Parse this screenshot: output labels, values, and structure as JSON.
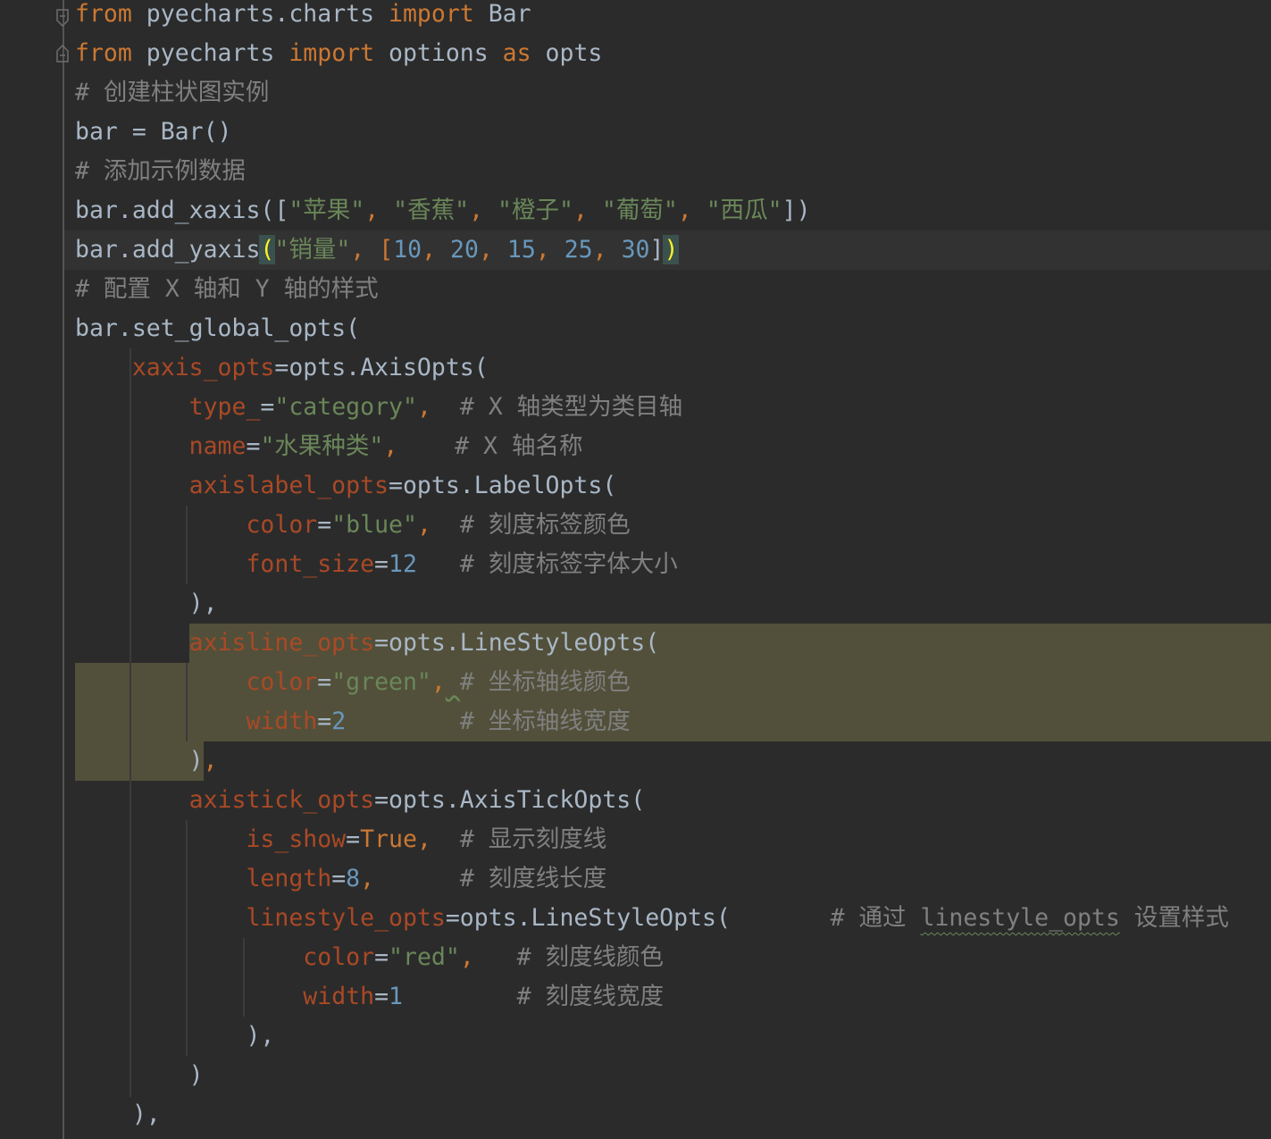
{
  "editor": {
    "theme_colors": {
      "background": "#2b2b2b",
      "keyword": "#cc7832",
      "string": "#6a8759",
      "number": "#6897bb",
      "comment": "#808080",
      "parameter": "#aa4926",
      "identifier": "#a9b7c6",
      "selection": "#52503a",
      "caret_row": "#323232",
      "brace_match": "#ffef28"
    },
    "icons": [
      "fold-open-icon",
      "fold-close-icon"
    ],
    "lines": [
      [
        "from",
        " pyecharts.charts ",
        "import",
        " Bar"
      ],
      [
        "from",
        " pyecharts ",
        "import",
        " options ",
        "as",
        " opts"
      ],
      [
        "# 创建柱状图实例"
      ],
      [
        "bar = Bar()"
      ],
      [
        "# 添加示例数据"
      ],
      [
        "bar.add_xaxis([",
        "\"苹果\"",
        ", ",
        "\"香蕉\"",
        ", ",
        "\"橙子\"",
        ", ",
        "\"葡萄\"",
        ", ",
        "\"西瓜\"",
        "])"
      ],
      [
        "bar.add_yaxis",
        "(",
        "\"销量\"",
        ", [",
        "10",
        ", ",
        "20",
        ", ",
        "15",
        ", ",
        "25",
        ", ",
        "30",
        "]",
        ")"
      ],
      [
        "# 配置 X 轴和 Y 轴的样式"
      ],
      [
        "bar.set_global_opts("
      ],
      [
        "    ",
        "xaxis_opts",
        "=opts.AxisOpts("
      ],
      [
        "        ",
        "type_",
        "=",
        "\"category\"",
        ",  ",
        "# X 轴类型为类目轴"
      ],
      [
        "        ",
        "name",
        "=",
        "\"水果种类\"",
        ",    ",
        "# X 轴名称"
      ],
      [
        "        ",
        "axislabel_opts",
        "=opts.LabelOpts("
      ],
      [
        "            ",
        "color",
        "=",
        "\"blue\"",
        ",  ",
        "# 刻度标签颜色"
      ],
      [
        "            ",
        "font_size",
        "=",
        "12",
        "   ",
        "# 刻度标签字体大小"
      ],
      [
        "        ",
        "),"
      ],
      [
        "        ",
        "axisline_opts",
        "=opts.LineStyleOpts("
      ],
      [
        "            ",
        "color",
        "=",
        "\"green\"",
        ",",
        " ",
        "# 坐标轴线颜色"
      ],
      [
        "            ",
        "width",
        "=",
        "2",
        "        ",
        "# 坐标轴线宽度"
      ],
      [
        "        ",
        ")",
        ","
      ],
      [
        "        ",
        "axistick_opts",
        "=opts.AxisTickOpts("
      ],
      [
        "            ",
        "is_show",
        "=",
        "True",
        ",  ",
        "# 显示刻度线"
      ],
      [
        "            ",
        "length",
        "=",
        "8",
        ",      ",
        "# 刻度线长度"
      ],
      [
        "            ",
        "linestyle_opts",
        "=opts.LineStyleOpts(",
        "       ",
        "# 通过 ",
        "linestyle_opts",
        " 设置样式"
      ],
      [
        "                ",
        "color",
        "=",
        "\"red\"",
        ",   ",
        "# 刻度线颜色"
      ],
      [
        "                ",
        "width",
        "=",
        "1",
        "        ",
        "# 刻度线宽度"
      ],
      [
        "            ",
        "),"
      ],
      [
        "        ",
        ")"
      ],
      [
        "    ",
        "),"
      ]
    ]
  }
}
